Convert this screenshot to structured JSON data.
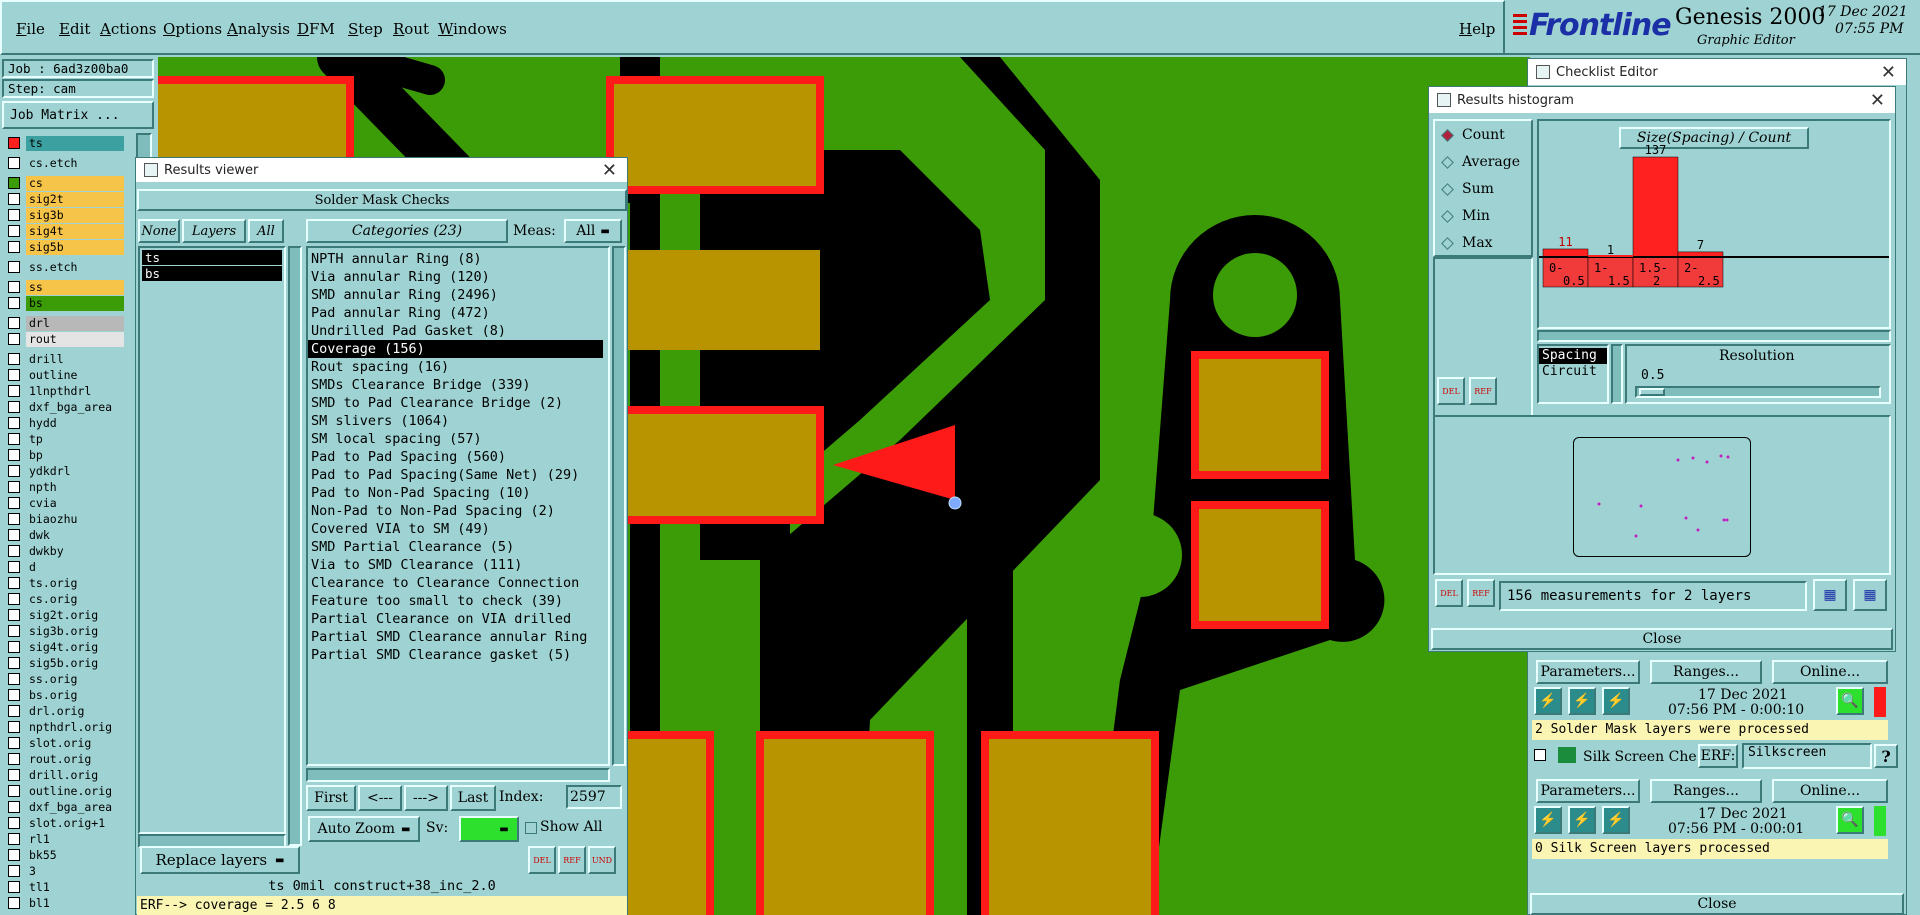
{
  "menubar": {
    "items": [
      "File",
      "Edit",
      "Actions",
      "Options",
      "Analysis",
      "DFM",
      "Step",
      "Rout",
      "Windows"
    ],
    "help": "Help",
    "brand": "Frontline",
    "product": "Genesis 2000",
    "subtitle": "Graphic Editor",
    "date": "17 Dec 2021",
    "time": "07:55 PM"
  },
  "left": {
    "job": "Job : 6ad3z00ba0",
    "step": "Step: cam",
    "job_matrix": "Job Matrix ...",
    "layers": [
      {
        "name": "ts",
        "color": "#3ca0a0",
        "mark": "#ff2020"
      },
      {
        "name": "cs.etch",
        "color": "#9fd3d3"
      },
      {
        "name": "cs",
        "color": "#f7c44a",
        "mark": "#3c9c08"
      },
      {
        "name": "sig2t",
        "color": "#f7c44a"
      },
      {
        "name": "sig3b",
        "color": "#f7c44a"
      },
      {
        "name": "sig4t",
        "color": "#f7c44a"
      },
      {
        "name": "sig5b",
        "color": "#f7c44a"
      },
      {
        "name": "ss.etch",
        "color": "#9fd3d3"
      },
      {
        "name": "ss",
        "color": "#f7c44a"
      },
      {
        "name": "bs",
        "color": "#3c9c08"
      },
      {
        "name": "drl",
        "color": "#b8b8b8"
      },
      {
        "name": "rout",
        "color": "#e4e4e4"
      },
      {
        "name": "drill",
        "color": "#9fd3d3"
      },
      {
        "name": "outline",
        "color": "#9fd3d3"
      },
      {
        "name": "1lnpthdrl",
        "color": "#9fd3d3"
      },
      {
        "name": "dxf_bga_area",
        "color": "#9fd3d3"
      },
      {
        "name": "hydd",
        "color": "#9fd3d3"
      },
      {
        "name": "tp",
        "color": "#9fd3d3"
      },
      {
        "name": "bp",
        "color": "#9fd3d3"
      },
      {
        "name": "ydkdrl",
        "color": "#9fd3d3"
      },
      {
        "name": "npth",
        "color": "#9fd3d3"
      },
      {
        "name": "cvia",
        "color": "#9fd3d3"
      },
      {
        "name": "biaozhu",
        "color": "#9fd3d3"
      },
      {
        "name": "dwk",
        "color": "#9fd3d3"
      },
      {
        "name": "dwkby",
        "color": "#9fd3d3"
      },
      {
        "name": "d",
        "color": "#9fd3d3"
      },
      {
        "name": "ts.orig",
        "color": "#9fd3d3"
      },
      {
        "name": "cs.orig",
        "color": "#9fd3d3"
      },
      {
        "name": "sig2t.orig",
        "color": "#9fd3d3"
      },
      {
        "name": "sig3b.orig",
        "color": "#9fd3d3"
      },
      {
        "name": "sig4t.orig",
        "color": "#9fd3d3"
      },
      {
        "name": "sig5b.orig",
        "color": "#9fd3d3"
      },
      {
        "name": "ss.orig",
        "color": "#9fd3d3"
      },
      {
        "name": "bs.orig",
        "color": "#9fd3d3"
      },
      {
        "name": "drl.orig",
        "color": "#9fd3d3"
      },
      {
        "name": "npthdrl.orig",
        "color": "#9fd3d3"
      },
      {
        "name": "slot.orig",
        "color": "#9fd3d3"
      },
      {
        "name": "rout.orig",
        "color": "#9fd3d3"
      },
      {
        "name": "drill.orig",
        "color": "#9fd3d3"
      },
      {
        "name": "outline.orig",
        "color": "#9fd3d3"
      },
      {
        "name": "dxf_bga_area",
        "color": "#9fd3d3"
      },
      {
        "name": "slot.orig+1",
        "color": "#9fd3d3"
      },
      {
        "name": "rl1",
        "color": "#9fd3d3"
      },
      {
        "name": "bk55",
        "color": "#9fd3d3"
      },
      {
        "name": "3",
        "color": "#9fd3d3"
      },
      {
        "name": "tl1",
        "color": "#9fd3d3"
      },
      {
        "name": "bl1",
        "color": "#9fd3d3"
      }
    ]
  },
  "results_viewer": {
    "title": "Results viewer",
    "header": "Solder Mask Checks",
    "none_btn": "None",
    "layers_btn": "Layers",
    "all_btn": "All",
    "layers": [
      "ts",
      "bs"
    ],
    "categories_header": "Categories (23)",
    "meas_label": "Meas:",
    "meas_value": "All",
    "categories": [
      "NPTH annular Ring (8)",
      "Via annular Ring (120)",
      "SMD annular Ring (2496)",
      "Pad annular Ring (472)",
      "Undrilled Pad Gasket (8)",
      "Coverage (156)",
      "Rout spacing (16)",
      "SMDs Clearance Bridge (339)",
      "SMD to Pad Clearance Bridge (2)",
      "SM slivers (1064)",
      "SM local spacing (57)",
      "Pad to Pad Spacing (560)",
      "Pad to Pad Spacing(Same Net) (29)",
      "Pad to Non-Pad Spacing (10)",
      "Non-Pad to Non-Pad Spacing (2)",
      "Covered VIA to SM (49)",
      "SMD Partial Clearance (5)",
      "Via to SMD Clearance (111)",
      "Clearance to Clearance Connection",
      "Feature too small to check (39)",
      "Partial Clearance on VIA drilled",
      "Partial SMD Clearance annular Ring",
      "Partial SMD Clearance gasket (5)"
    ],
    "selected_index": 5,
    "first": "First",
    "prev": "<---",
    "next": "--->",
    "last": "Last",
    "index_label": "Index:",
    "index_value": "2597",
    "auto_zoom": "Auto Zoom",
    "sv_label": "Sv:",
    "show_all": "Show All",
    "replace_layers": "Replace layers",
    "status_line": "ts 0mil  construct+38_inc_2.0",
    "erf_line": "ERF--> coverage = 2.5 6 8"
  },
  "histogram": {
    "title": "Results histogram",
    "options": [
      "Count",
      "Average",
      "Sum",
      "Min",
      "Max"
    ],
    "selected_option": "Count",
    "chart_title": "Size(Spacing) / Count",
    "spacing_label": "Spacing",
    "circuit_label": "Circuit",
    "resolution_label": "Resolution",
    "resolution_value": "0.5",
    "summary": "156 measurements for 2 layers",
    "close": "Close"
  },
  "chart_data": {
    "type": "bar",
    "title": "Size(Spacing) / Count",
    "categories": [
      "0-0.5",
      "1-1.5",
      "1.5-2",
      "2-2.5"
    ],
    "values": [
      11,
      1,
      137,
      7
    ],
    "bar_color": "#ff2020"
  },
  "checklist": {
    "title": "Checklist Editor",
    "params": "Parameters...",
    "ranges": "Ranges...",
    "online": "Online...",
    "run1_date": "17 Dec 2021",
    "run1_time": "07:56 PM - 0:00:10",
    "run1_status": "2 Solder Mask layers were processed",
    "silk_label": "Silk Screen Che",
    "erf_label": "ERF:",
    "erf_value": "Silkscreen",
    "question": "?",
    "run2_date": "17 Dec 2021",
    "run2_time": "07:56 PM - 0:00:01",
    "run2_status": "0 Silk Screen layers processed",
    "close": "Close"
  },
  "colors": {
    "background": "#9fd3d3",
    "board_green": "#3c9c08",
    "copper_black": "#000000",
    "pad_gold": "#b89400",
    "clearance_red": "#ff1a1a"
  }
}
